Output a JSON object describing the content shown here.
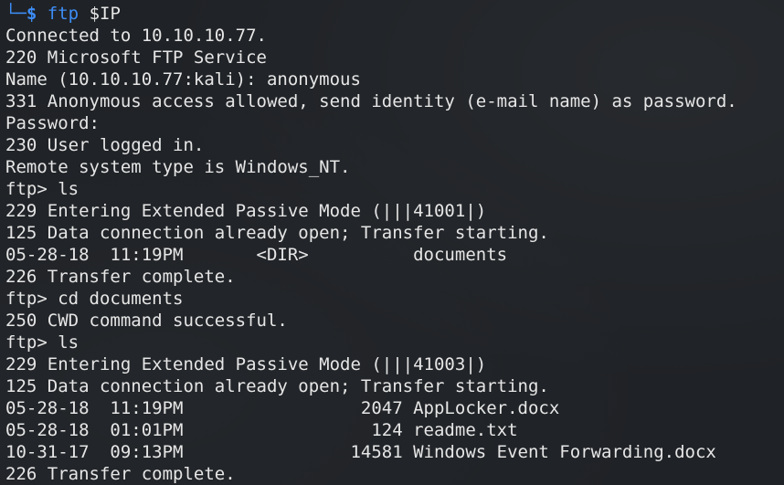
{
  "colors": {
    "background": "#1f2226",
    "text": "#e6e6e6",
    "prompt": "#3d8df5"
  },
  "prompt": {
    "corner": "└─",
    "dollar": "$",
    "command": "ftp",
    "argument": "$IP"
  },
  "output": [
    "Connected to 10.10.10.77.",
    "220 Microsoft FTP Service",
    "Name (10.10.10.77:kali): anonymous",
    "331 Anonymous access allowed, send identity (e-mail name) as password.",
    "Password:",
    "230 User logged in.",
    "Remote system type is Windows_NT.",
    "ftp> ls",
    "229 Entering Extended Passive Mode (|||41001|)",
    "125 Data connection already open; Transfer starting.",
    "05-28-18  11:19PM       <DIR>          documents",
    "226 Transfer complete.",
    "ftp> cd documents",
    "250 CWD command successful.",
    "ftp> ls",
    "229 Entering Extended Passive Mode (|||41003|)",
    "125 Data connection already open; Transfer starting.",
    "05-28-18  11:19PM                 2047 AppLocker.docx",
    "05-28-18  01:01PM                  124 readme.txt",
    "10-31-17  09:13PM                14581 Windows Event Forwarding.docx",
    "226 Transfer complete."
  ]
}
